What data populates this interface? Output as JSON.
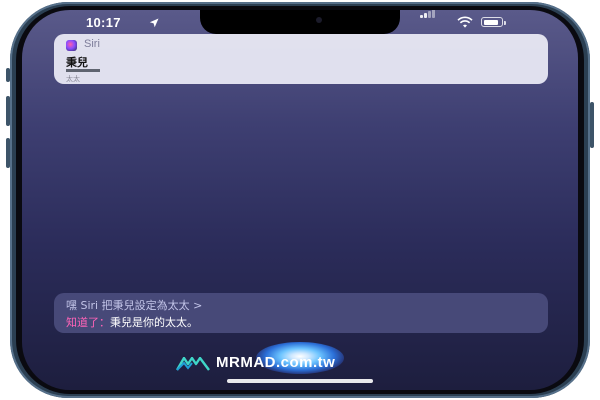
{
  "status_bar": {
    "time": "10:17",
    "location_icon": "location-arrow-icon",
    "signal_icon": "cellular-signal-icon",
    "wifi_icon": "wifi-icon",
    "battery_icon": "battery-icon",
    "battery_level": 0.85
  },
  "contact_card": {
    "app_icon": "siri-app-icon",
    "app_name": "Siri",
    "contact_name": "秉兒",
    "relation": "太太"
  },
  "response": {
    "user_request": "嘿 Siri 把秉兒設定為太太 >",
    "reply_prefix": "知道了：",
    "reply_body": "秉兒是你的太太。"
  },
  "siri_orb_icon": "siri-orb-icon",
  "watermark": {
    "logo": "mrmad-logo-icon",
    "text": "MRMAD.com.tw"
  },
  "colors": {
    "background_top": "#5a5a8a",
    "background_bottom": "#1d1e3e",
    "reply_prefix": "#ff63b8",
    "frame": "#2b3f52"
  }
}
